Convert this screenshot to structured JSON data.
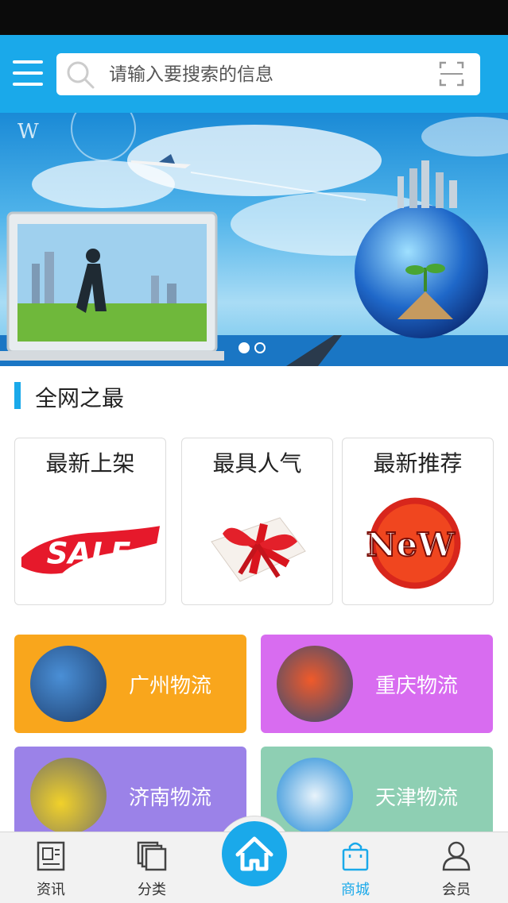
{
  "search": {
    "placeholder": "请输入要搜索的信息"
  },
  "banner": {
    "slides": 2,
    "active_slide": 1
  },
  "section": {
    "title": "全网之最"
  },
  "promos": [
    {
      "title": "最新上架",
      "image": "sale-brush-icon"
    },
    {
      "title": "最具人气",
      "image": "gift-box-icon"
    },
    {
      "title": "最新推荐",
      "image": "new-badge-icon"
    }
  ],
  "categories": [
    {
      "label": "广州物流",
      "color": "#f9a61c"
    },
    {
      "label": "重庆物流",
      "color": "#d86cf0"
    },
    {
      "label": "济南物流",
      "color": "#9b82e8"
    },
    {
      "label": "天津物流",
      "color": "#8ecfb3"
    }
  ],
  "nav": [
    {
      "label": "资讯",
      "icon": "news-icon"
    },
    {
      "label": "分类",
      "icon": "category-icon"
    },
    {
      "label": "home",
      "icon": "home-icon"
    },
    {
      "label": "商城",
      "icon": "shop-bag-icon"
    },
    {
      "label": "会员",
      "icon": "member-icon"
    }
  ],
  "colors": {
    "accent": "#1aa9ea",
    "status_bar": "#0b0b0b"
  }
}
